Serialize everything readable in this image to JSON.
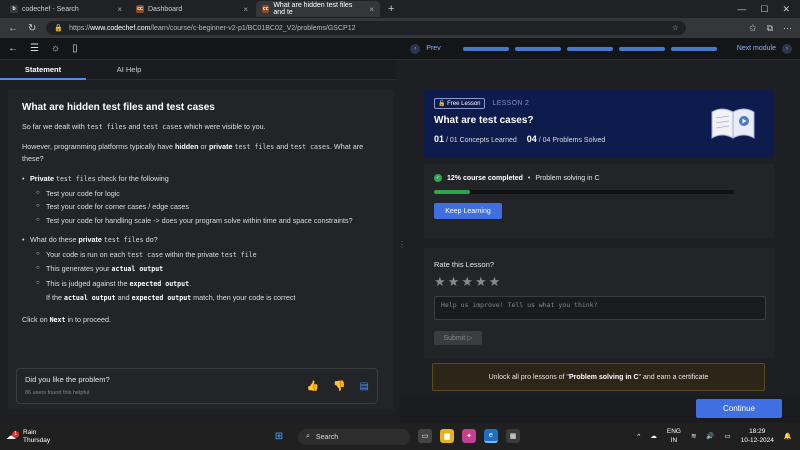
{
  "browser": {
    "tabs": [
      {
        "title": "codechef - Search",
        "fav": "b",
        "color": "#3b3b3b"
      },
      {
        "title": "Dashboard",
        "fav": "cc",
        "color": "#8a4b2a"
      },
      {
        "title": "What are hidden test files and te",
        "fav": "cc",
        "color": "#8a4b2a"
      }
    ],
    "url_prefix": "https://",
    "url_domain": "www.codechef.com",
    "url_path": "/learn/course/c-beginner-v2-p1/BC01BC02_V2/problems/GSCP12"
  },
  "toolbar": {
    "prev": "Prev",
    "next": "Next module"
  },
  "subtabs": {
    "statement": "Statement",
    "ai_help": "AI Help"
  },
  "statement": {
    "title": "What are hidden test files and test cases",
    "p1_a": "So far we dealt with ",
    "p1_code1": "test files",
    "p1_b": " and ",
    "p1_code2": "test cases",
    "p1_c": " which were visible to you.",
    "p2_a": "However, programming platforms typically have ",
    "p2_b1": "hidden",
    "p2_b": " or ",
    "p2_b2": "private",
    "p2_c": " ",
    "p2_code1": "test files",
    "p2_d": " and ",
    "p2_code2": "test cases",
    "p2_e": ". What are these?",
    "b1_bold": "Private",
    "b1_code": "test files",
    "b1_rest": " check for the following",
    "b1_sub": [
      "Test your code for logic",
      "Test your code for corner cases / edge cases",
      "Test your code for handling scale -> does your program solve within time and space constraints?"
    ],
    "b2_a": "What do these ",
    "b2_bold": "private",
    "b2_code": "test files",
    "b2_rest": " do?",
    "b2_s1_a": "Your code is run on each ",
    "b2_s1_code1": "test case",
    "b2_s1_b": " within the private ",
    "b2_s1_code2": "test file",
    "b2_s2_a": "This generates your ",
    "b2_s2_code": "actual output",
    "b2_s3_a": "This is judged against the ",
    "b2_s3_code": "expected output",
    "b2_s3_b": ".",
    "b2_s4_a": "If the ",
    "b2_s4_code1": "actual output",
    "b2_s4_b": " and ",
    "b2_s4_code2": "expected output",
    "b2_s4_c": " match, then your code is correct",
    "click_a": "Click on ",
    "click_code": "Next",
    "click_b": " in to proceed."
  },
  "feedback": {
    "question": "Did you like the problem?",
    "count": "86 users found this helpful"
  },
  "lesson": {
    "badge": "Free Lesson",
    "lesson_no": "LESSON 2",
    "title": "What are test cases?",
    "concepts_num": "01",
    "concepts_text": "/ 01 Concepts Learned",
    "problems_num": "04",
    "problems_text": "/ 04 Problems Solved"
  },
  "progress": {
    "percent_text": "12% course completed",
    "sep": " • ",
    "course": "Problem solving in C",
    "fraction": 0.12,
    "keep_label": "Keep Learning"
  },
  "rate": {
    "title": "Rate this Lesson?",
    "placeholder": "Help us improve! Tell us what you think?",
    "submit": "Submit ▷",
    "stars": 5
  },
  "pro": {
    "a": "Unlock all pro lessons of \"",
    "b": "Problem solving in C",
    "c": "\" and earn a certificate"
  },
  "continue_label": "Continue",
  "taskbar": {
    "weather_badge": "1",
    "weather_title": "Rain",
    "weather_day": "Thursday",
    "search": "Search",
    "lang1": "ENG",
    "lang2": "IN",
    "time": "18:29",
    "date": "10-12-2024"
  }
}
